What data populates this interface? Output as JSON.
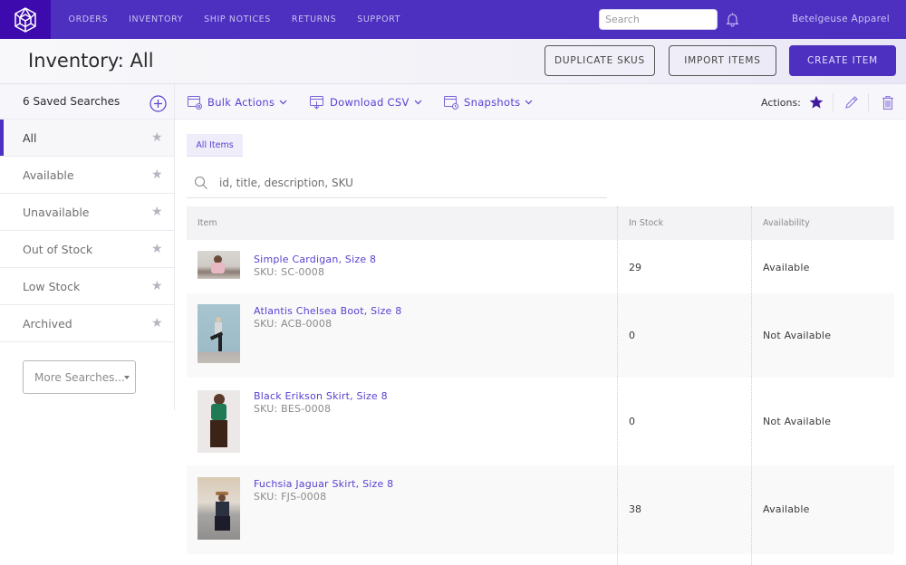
{
  "nav": {
    "links": [
      "ORDERS",
      "INVENTORY",
      "SHIP NOTICES",
      "RETURNS",
      "SUPPORT"
    ],
    "search_placeholder": "Search",
    "org_name": "Betelgeuse Apparel",
    "brand_color": "#4d30c0"
  },
  "header": {
    "title": "Inventory: All",
    "buttons": {
      "duplicate": "DUPLICATE SKUS",
      "import": "IMPORT ITEMS",
      "create": "CREATE ITEM"
    }
  },
  "sidebar": {
    "title": "6 Saved Searches",
    "items": [
      {
        "label": "All",
        "active": true
      },
      {
        "label": "Available",
        "active": false
      },
      {
        "label": "Unavailable",
        "active": false
      },
      {
        "label": "Out of Stock",
        "active": false
      },
      {
        "label": "Low Stock",
        "active": false
      },
      {
        "label": "Archived",
        "active": false
      }
    ],
    "more_searches": "More Searches..."
  },
  "toolbar": {
    "bulk_actions": "Bulk Actions",
    "download_csv": "Download CSV",
    "snapshots": "Snapshots",
    "actions_label": "Actions:"
  },
  "content": {
    "tab": "All Items",
    "filter_placeholder": "id, title, description, SKU",
    "columns": {
      "item": "Item",
      "stock": "In Stock",
      "availability": "Availability"
    },
    "rows": [
      {
        "title": "Simple Cardigan, Size 8",
        "sku": "SKU: SC-0008",
        "stock": "29",
        "availability": "Available"
      },
      {
        "title": "Atlantis Chelsea Boot, Size 8",
        "sku": "SKU: ACB-0008",
        "stock": "0",
        "availability": "Not Available"
      },
      {
        "title": "Black Erikson Skirt, Size 8",
        "sku": "SKU: BES-0008",
        "stock": "0",
        "availability": "Not Available"
      },
      {
        "title": "Fuchsia Jaguar Skirt, Size 8",
        "sku": "SKU: FJS-0008",
        "stock": "38",
        "availability": "Available"
      }
    ]
  }
}
